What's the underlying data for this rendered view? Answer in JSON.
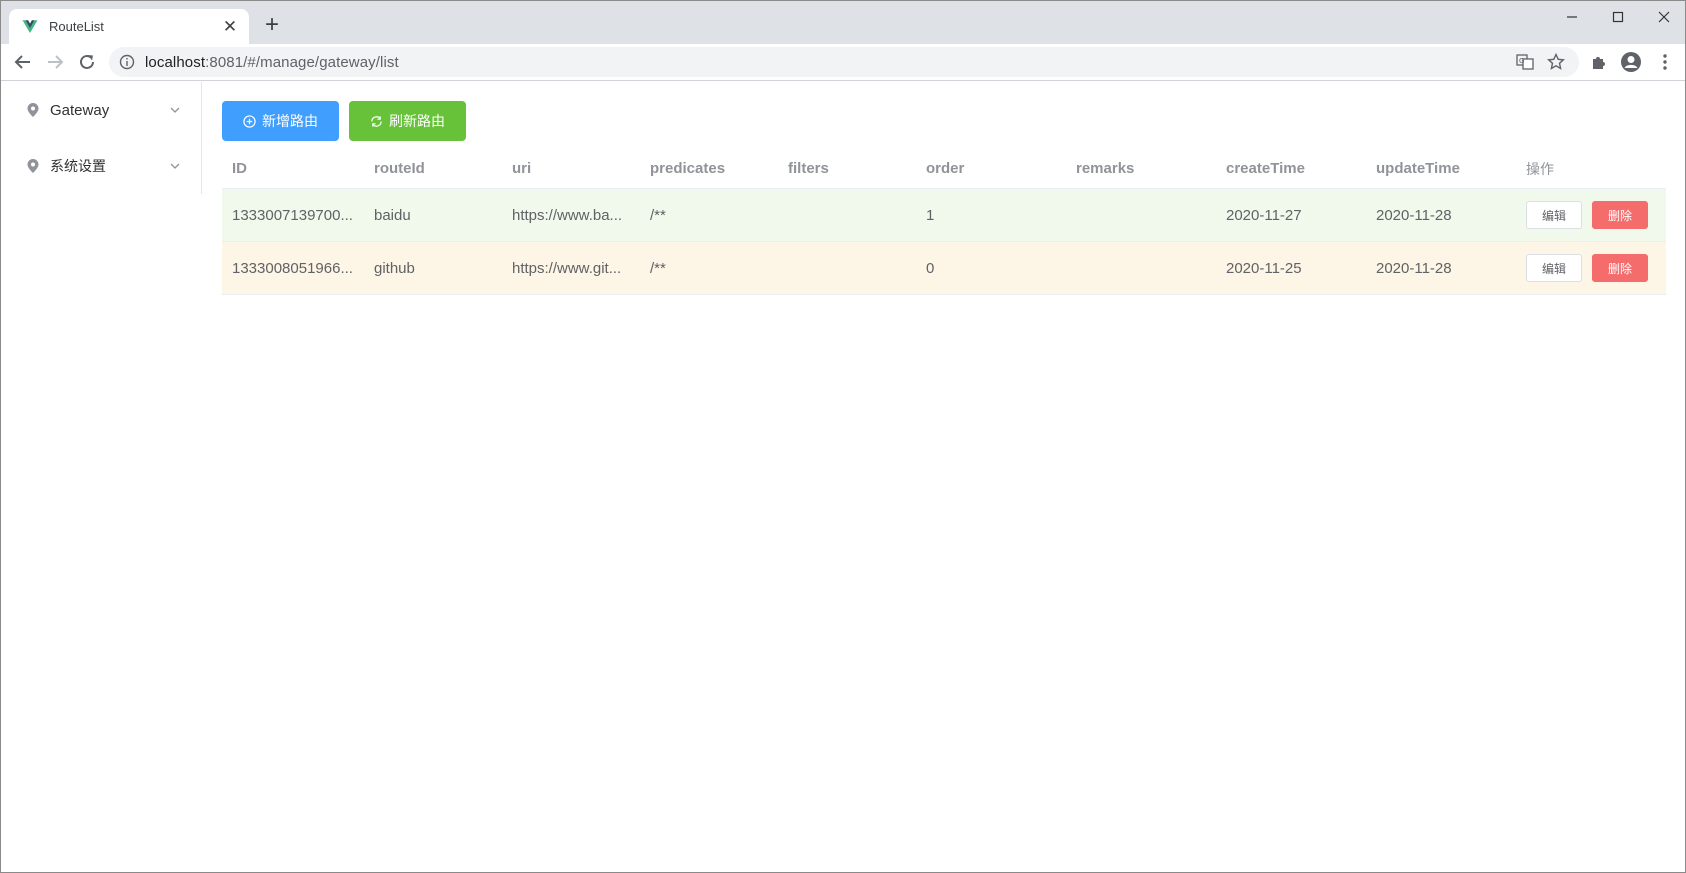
{
  "browser": {
    "tab_title": "RouteList",
    "new_tab": "+",
    "url_host": "localhost",
    "url_rest": ":8081/#/manage/gateway/list"
  },
  "sidebar": {
    "items": [
      {
        "label": "Gateway",
        "icon": "location-pin-icon"
      },
      {
        "label": "系统设置",
        "icon": "location-pin-icon"
      }
    ]
  },
  "actions": {
    "add_label": "新增路由",
    "refresh_label": "刷新路由"
  },
  "table": {
    "columns": [
      "ID",
      "routeId",
      "uri",
      "predicates",
      "filters",
      "order",
      "remarks",
      "createTime",
      "updateTime",
      "操作"
    ],
    "rows": [
      {
        "id": "1333007139700...",
        "routeId": "baidu",
        "uri": "https://www.ba...",
        "predicates": "/**",
        "filters": "",
        "order": "1",
        "remarks": "",
        "createTime": "2020-11-27",
        "updateTime": "2020-11-28",
        "edit": "编辑",
        "delete": "删除"
      },
      {
        "id": "1333008051966...",
        "routeId": "github",
        "uri": "https://www.git...",
        "predicates": "/**",
        "filters": "",
        "order": "0",
        "remarks": "",
        "createTime": "2020-11-25",
        "updateTime": "2020-11-28",
        "edit": "编辑",
        "delete": "删除"
      }
    ]
  },
  "colors": {
    "primary": "#409eff",
    "success": "#67c23a",
    "danger": "#f56c6c",
    "row_success_bg": "#f0f9eb",
    "row_warning_bg": "#fdf5e6"
  }
}
